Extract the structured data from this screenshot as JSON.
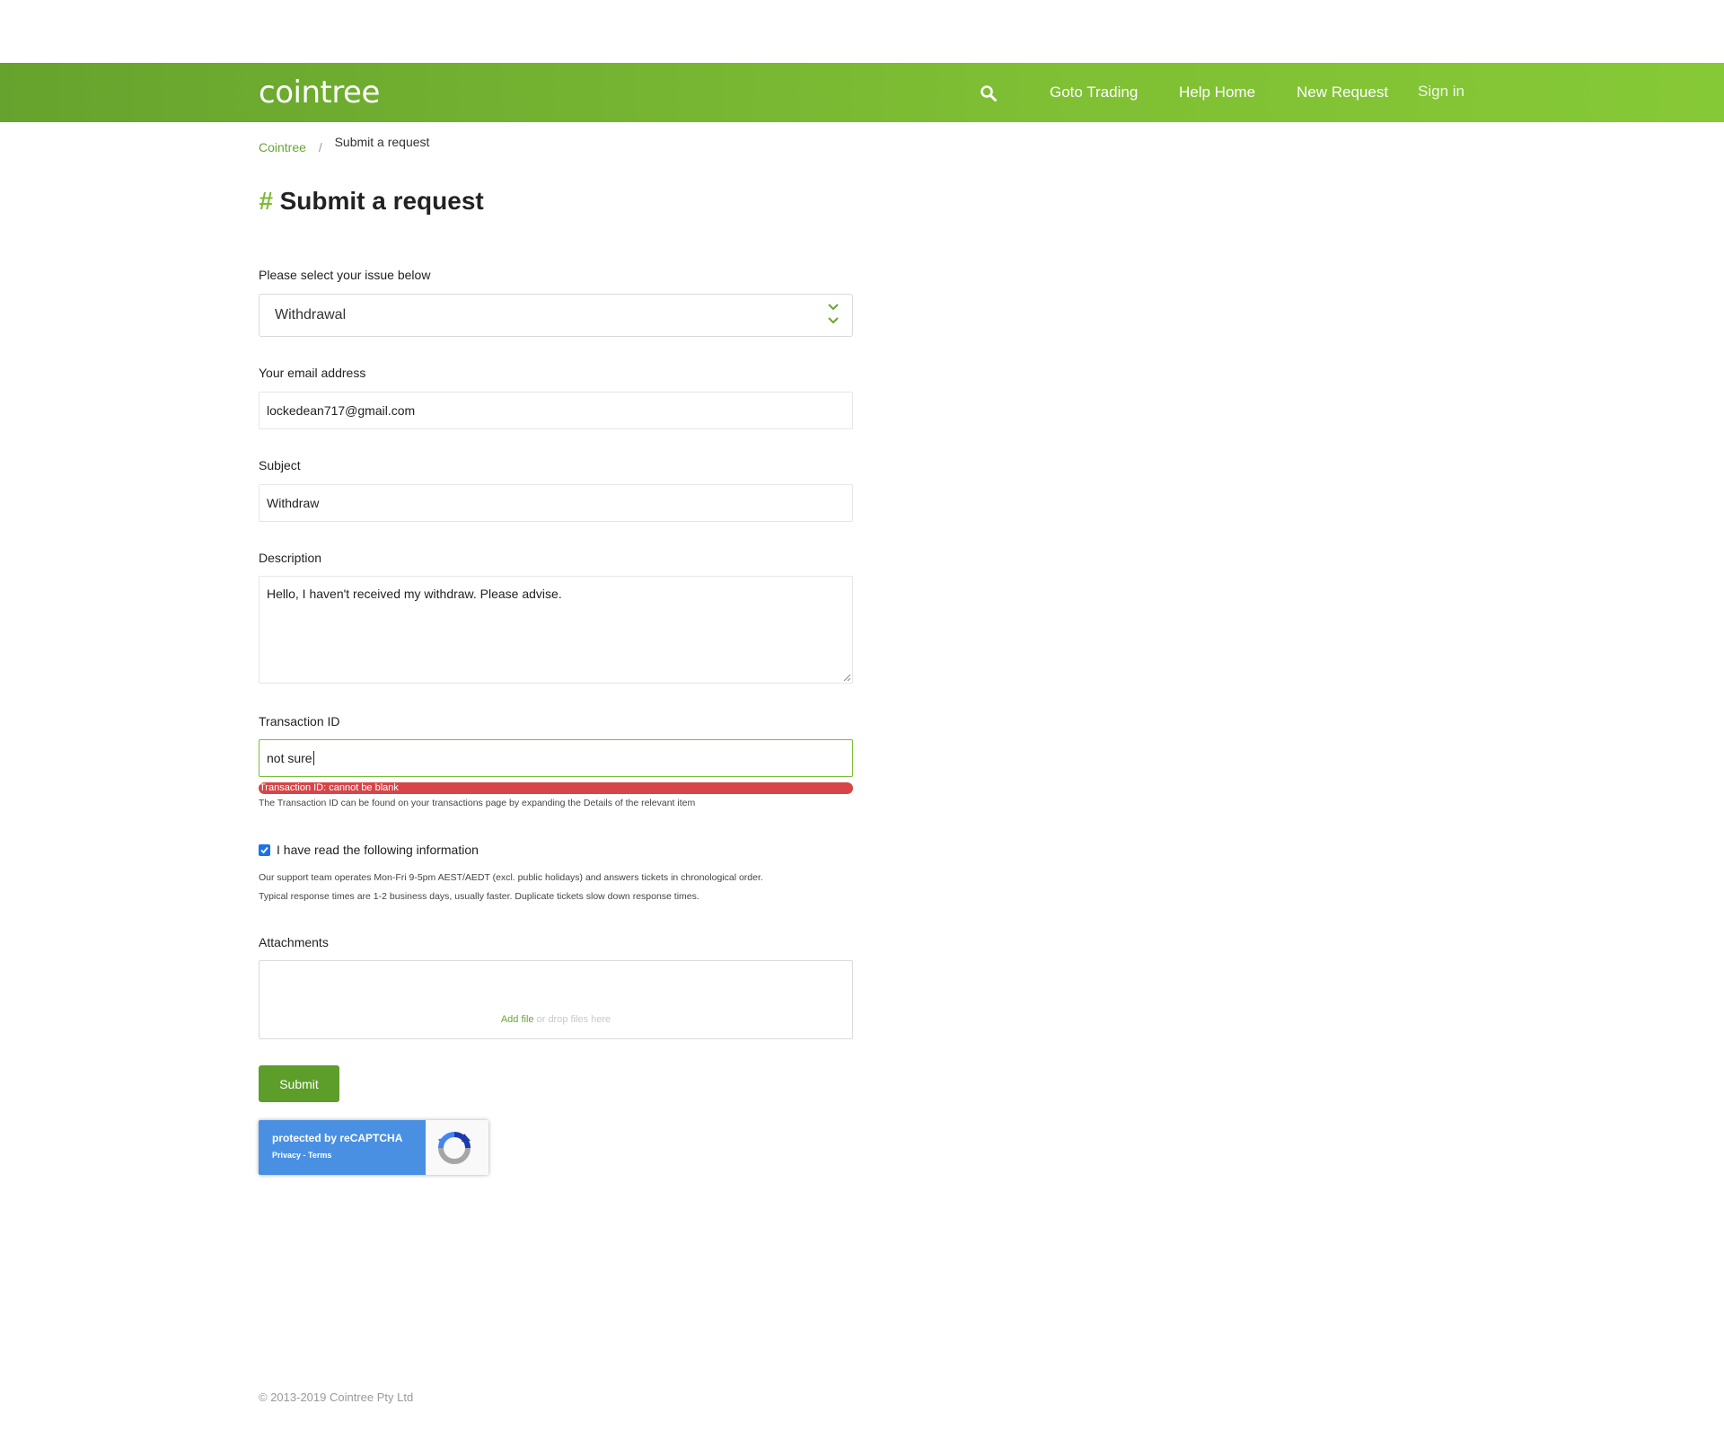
{
  "header": {
    "logo": "cointree",
    "nav": {
      "search_icon": "search-icon",
      "goto_trading": "Goto Trading",
      "help_home": "Help Home",
      "new_request": "New Request",
      "sign_in": "Sign in"
    }
  },
  "breadcrumb": {
    "home": "Cointree",
    "separator": "/",
    "current": "Submit a request"
  },
  "page": {
    "hash": "#",
    "title": "Submit a request"
  },
  "form": {
    "issue": {
      "label": "Please select your issue below",
      "selected": "Withdrawal"
    },
    "email": {
      "label": "Your email address",
      "value": "lockedean717@gmail.com"
    },
    "subject": {
      "label": "Subject",
      "value": "Withdraw"
    },
    "description": {
      "label": "Description",
      "value": "Hello, I haven't received my withdraw. Please advise."
    },
    "transaction_id": {
      "label": "Transaction ID",
      "value": "not sure",
      "error": "Transaction ID: cannot be blank",
      "hint": "The Transaction ID can be found on your transactions page by expanding the Details of the relevant item"
    },
    "acknowledge": {
      "label": "I have read the following information",
      "checked": true,
      "info_line1": "Our support team operates Mon-Fri 9-5pm AEST/AEDT (excl. public holidays) and answers tickets in chronological order.",
      "info_line2": "Typical response times are 1-2 business days, usually faster. Duplicate tickets slow down response times."
    },
    "attachments": {
      "label": "Attachments",
      "add_file": "Add file",
      "drop_hint": " or drop files here"
    },
    "submit_label": "Submit"
  },
  "recaptcha": {
    "title": "protected by reCAPTCHA",
    "privacy": "Privacy",
    "sep": " - ",
    "terms": "Terms"
  },
  "footer": {
    "copyright": "© 2013-2019 Cointree Pty Ltd"
  },
  "colors": {
    "brand_green": "#7cbc36",
    "error_red": "#d64548",
    "button_green": "#5d9e2a",
    "recaptcha_blue": "#4a90e2"
  }
}
